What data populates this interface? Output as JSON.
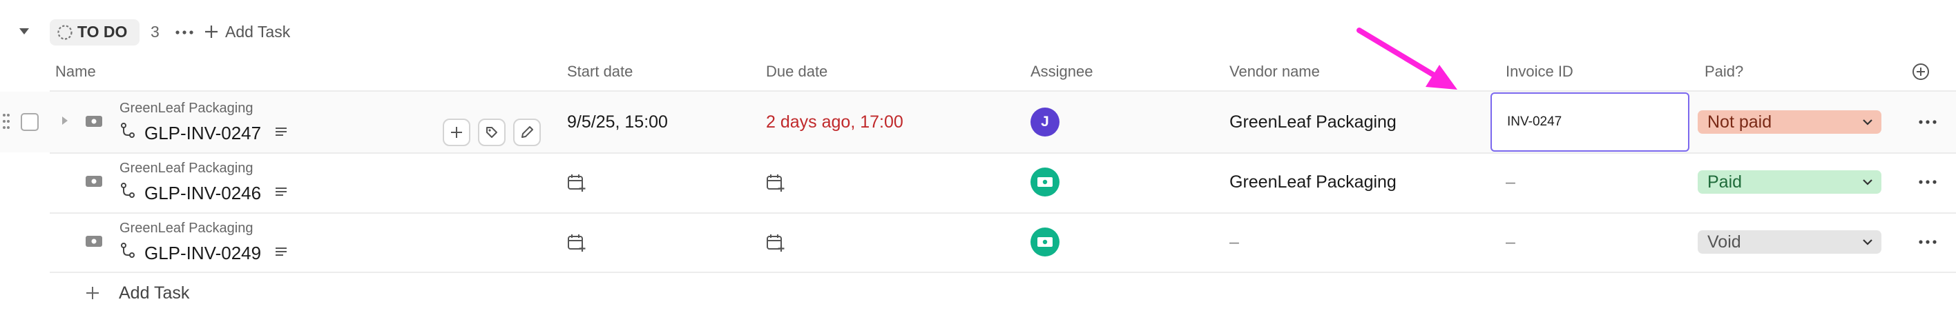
{
  "group": {
    "status_label": "TO DO",
    "count": "3",
    "add_task_label": "Add Task"
  },
  "columns": {
    "name": "Name",
    "start_date": "Start date",
    "due_date": "Due date",
    "assignee": "Assignee",
    "vendor_name": "Vendor name",
    "invoice_id": "Invoice ID",
    "paid": "Paid?"
  },
  "tasks": [
    {
      "parent": "GreenLeaf Packaging",
      "title": "GLP-INV-0247",
      "start_date": "9/5/25, 15:00",
      "due_date": "2 days ago, 17:00",
      "assignee_initial": "J",
      "vendor_name": "GreenLeaf Packaging",
      "invoice_id": "INV-0247",
      "paid": "Not paid"
    },
    {
      "parent": "GreenLeaf Packaging",
      "title": "GLP-INV-0246",
      "vendor_name": "GreenLeaf Packaging",
      "invoice_id": "–",
      "paid": "Paid"
    },
    {
      "parent": "GreenLeaf Packaging",
      "title": "GLP-INV-0249",
      "vendor_name": "–",
      "invoice_id": "–",
      "paid": "Void"
    }
  ],
  "footer": {
    "add_task_label": "Add Task"
  },
  "colors": {
    "due_overdue": "#c0292b",
    "assignee_j": "#5a3fd1",
    "assignee_bot": "#0fb38a",
    "not_paid_bg": "#f6c4b4",
    "paid_bg": "#c8efd2",
    "void_bg": "#e5e5e5",
    "focus_border": "#7b68ee",
    "annotation_arrow": "#ff22dd"
  },
  "icons": {
    "collapse": "caret-down-icon",
    "status": "dashed-circle-icon",
    "more": "more-horizontal-icon",
    "plus": "plus-icon",
    "drag": "drag-handle-icon",
    "task_type": "money-icon",
    "subtask": "subtask-branch-icon",
    "description": "description-lines-icon",
    "tag": "tag-icon",
    "edit": "pencil-icon",
    "calendar_add": "calendar-plus-icon",
    "dropdown": "chevron-down-icon",
    "add_column": "plus-circle-icon",
    "annotation": "pointer-arrow-icon"
  }
}
